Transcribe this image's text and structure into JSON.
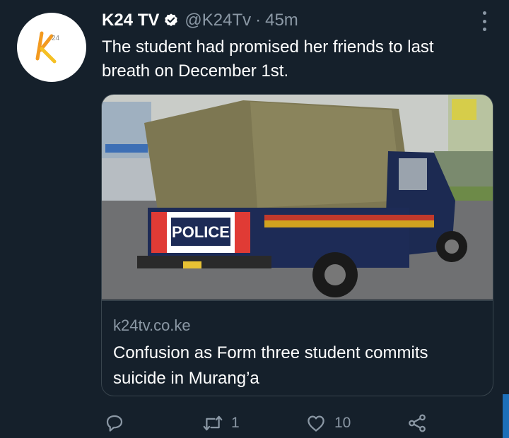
{
  "tweet": {
    "author_name": "K24 TV",
    "handle": "@K24Tv",
    "separator": "·",
    "time": "45m",
    "text": "The student had promised her friends to last breath on December 1st.",
    "avatar_logo": "k24-logo",
    "verified_icon": "verified-badge-icon"
  },
  "card": {
    "domain": "k24tv.co.ke",
    "title": "Confusion as Form three student commits suicide in Murang’a",
    "image_texts": {
      "police_label": "POLICE"
    }
  },
  "actions": {
    "reply": {
      "icon": "reply-icon",
      "count": ""
    },
    "retweet": {
      "icon": "retweet-icon",
      "count": "1"
    },
    "like": {
      "icon": "like-icon",
      "count": "10"
    },
    "share": {
      "icon": "share-icon",
      "count": ""
    }
  },
  "colors": {
    "background": "#15202b",
    "muted_text": "#8b98a5",
    "border": "#38444d",
    "logo_orange": "#f39a1f"
  }
}
